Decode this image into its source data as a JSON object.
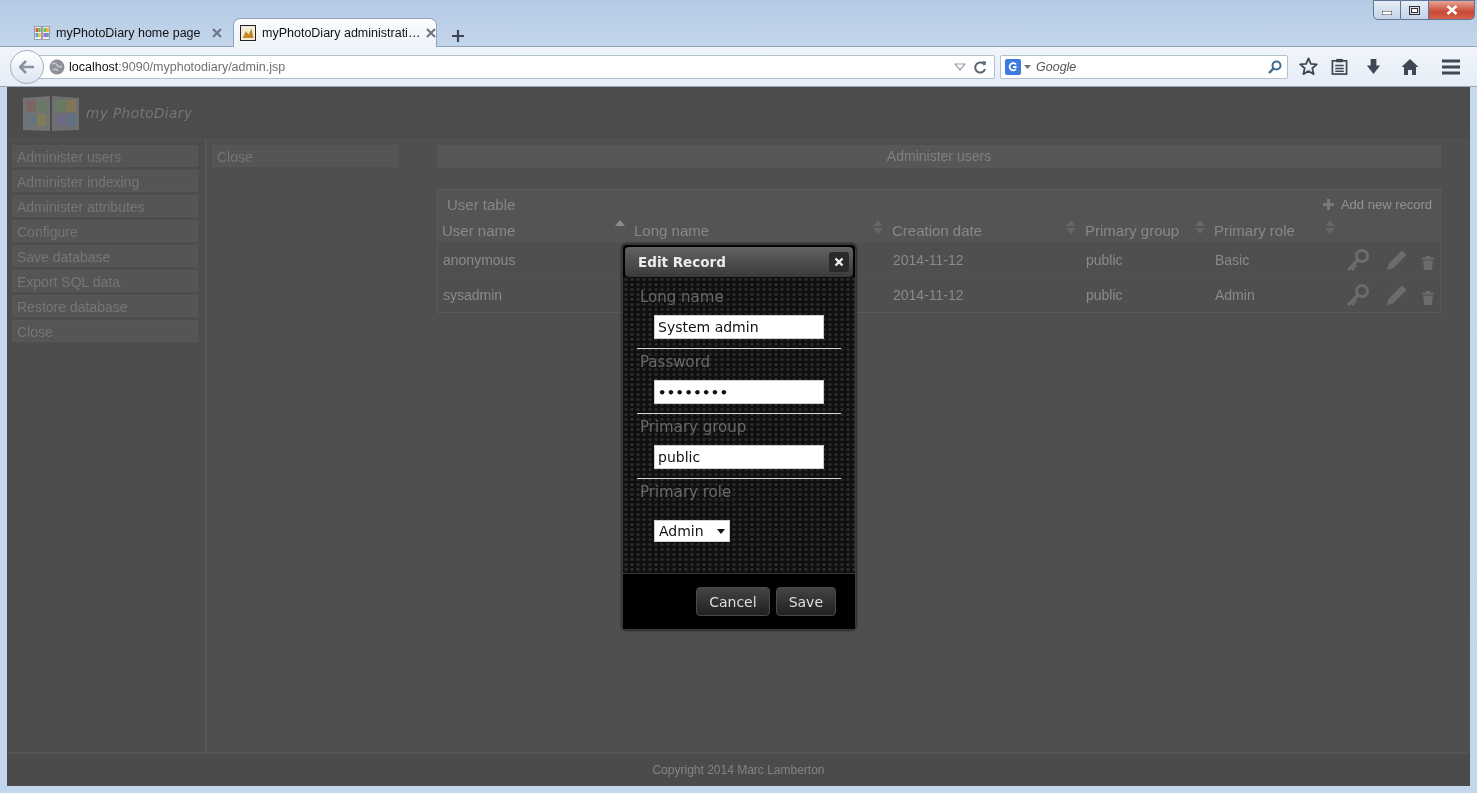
{
  "browser": {
    "tabs": [
      {
        "title": "myPhotoDiary home page",
        "selected": false
      },
      {
        "title": "myPhotoDiary administrati…",
        "selected": true
      }
    ],
    "address": {
      "host": "localhost",
      "path": ":9090/myphotodiary/admin.jsp"
    },
    "search": {
      "placeholder": "Google"
    }
  },
  "header": {
    "logo_text": "my PhotoDiary"
  },
  "sidebar": {
    "items": [
      {
        "label": "Administer users"
      },
      {
        "label": "Administer indexing"
      },
      {
        "label": "Administer attributes"
      },
      {
        "label": "Configure"
      },
      {
        "label": "Save database"
      },
      {
        "label": "Export SQL data"
      },
      {
        "label": "Restore database"
      },
      {
        "label": "Close"
      }
    ]
  },
  "subnav": {
    "items": [
      {
        "label": "Close"
      }
    ]
  },
  "panel": {
    "title": "Administer users"
  },
  "table": {
    "title": "User table",
    "add_button": "Add new record",
    "columns": [
      {
        "label": "User name",
        "sorted": true
      },
      {
        "label": "Long name",
        "sorted": false
      },
      {
        "label": "Creation date",
        "sorted": false
      },
      {
        "label": "Primary group",
        "sorted": false
      },
      {
        "label": "Primary role",
        "sorted": false
      }
    ],
    "rows": [
      {
        "user_name": "anonymous",
        "creation_date": "2014-11-12",
        "primary_group": "public",
        "primary_role": "Basic"
      },
      {
        "user_name": "sysadmin",
        "creation_date": "2014-11-12",
        "primary_group": "public",
        "primary_role": "Admin"
      }
    ]
  },
  "dialog": {
    "title": "Edit Record",
    "fields": [
      {
        "label": "Long name",
        "kind": "text",
        "value": "System admin"
      },
      {
        "label": "Password",
        "kind": "password",
        "value": "••••••••"
      },
      {
        "label": "Primary group",
        "kind": "text",
        "value": "public"
      },
      {
        "label": "Primary role",
        "kind": "select",
        "value": "Admin"
      }
    ],
    "buttons": [
      {
        "label": "Cancel"
      },
      {
        "label": "Save"
      }
    ]
  },
  "footer": {
    "text": "Copyright 2014 Marc Lamberton"
  }
}
